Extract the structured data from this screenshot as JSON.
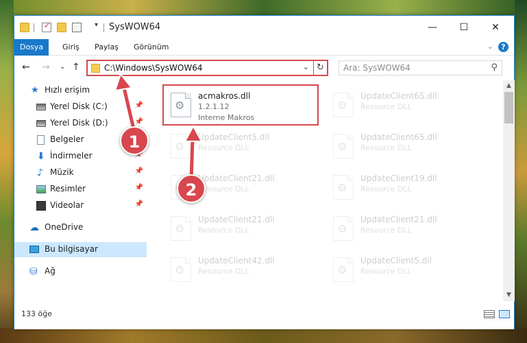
{
  "window": {
    "title": "SysWOW64",
    "controls": {
      "minimize": "—",
      "maximize": "☐",
      "close": "✕"
    }
  },
  "ribbon": {
    "tabs": [
      "Dosya",
      "Giriş",
      "Paylaş",
      "Görünüm"
    ],
    "help": "?"
  },
  "address": {
    "path": "C:\\Windows\\SysWOW64",
    "search_placeholder": "Ara: SysWOW64"
  },
  "nav": {
    "items": [
      {
        "label": "Hızlı erişim",
        "icon": "star-icon",
        "pinned": false
      },
      {
        "label": "Yerel Disk (C:)",
        "icon": "drive-icon",
        "pinned": true
      },
      {
        "label": "Yerel Disk (D:)",
        "icon": "drive-icon",
        "pinned": true
      },
      {
        "label": "Belgeler",
        "icon": "documents-icon",
        "pinned": true
      },
      {
        "label": "İndirmeler",
        "icon": "download-icon",
        "pinned": true
      },
      {
        "label": "Müzik",
        "icon": "music-icon",
        "pinned": true
      },
      {
        "label": "Resimler",
        "icon": "pictures-icon",
        "pinned": true
      },
      {
        "label": "Videolar",
        "icon": "videos-icon",
        "pinned": true
      },
      {
        "label": "OneDrive",
        "icon": "cloud-icon",
        "pinned": false
      },
      {
        "label": "Bu bilgisayar",
        "icon": "computer-icon",
        "pinned": false
      },
      {
        "label": "Ağ",
        "icon": "network-icon",
        "pinned": false
      }
    ]
  },
  "files": [
    {
      "name": "acmakros.dll",
      "line2": "1.2.1.12",
      "line3": "Interne Makros",
      "highlight": true
    },
    {
      "name": "UpdateClient65.dll",
      "line2": "Resource DLL"
    },
    {
      "name": "UpdateClient5.dll",
      "line2": "Resource DLL"
    },
    {
      "name": "UpdateClient65.dll",
      "line2": "Resource DLL"
    },
    {
      "name": "UpdateClient21.dll",
      "line2": "Resource DLL"
    },
    {
      "name": "UpdateClient19.dll",
      "line2": "Resource DLL"
    },
    {
      "name": "UpdateClient21.dll",
      "line2": "Resource DLL"
    },
    {
      "name": "UpdateClient21.dll",
      "line2": "Resource DLL"
    },
    {
      "name": "UpdateClient42.dll",
      "line2": "Resource DLL"
    },
    {
      "name": "UpdateClient5.dll",
      "line2": "Resource DLL"
    }
  ],
  "status": {
    "count": "133 öğe"
  },
  "callouts": {
    "step1": "1",
    "step2": "2"
  },
  "colors": {
    "accent": "#1979ca",
    "highlight": "#d5494f",
    "selected": "#cce8ff"
  }
}
